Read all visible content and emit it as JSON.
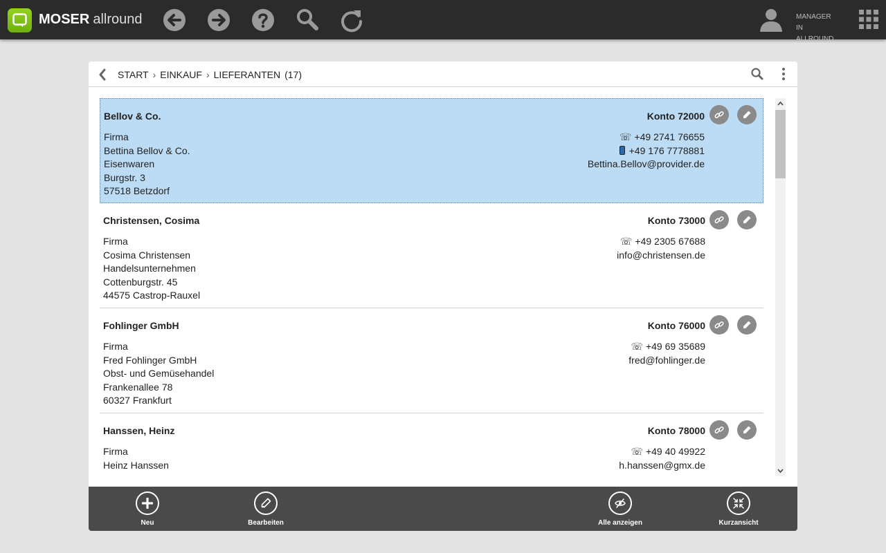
{
  "app": {
    "brand_bold": "MOSER",
    "brand_light": "allround"
  },
  "user": {
    "line1": "MANAGER",
    "line2": "IN ALLROUND"
  },
  "breadcrumb": {
    "items": [
      "START",
      "EINKAUF",
      "LIEFERANTEN"
    ],
    "separator": "›",
    "count": "(17)"
  },
  "records": [
    {
      "name": "Bellov & Co.",
      "konto": "Konto 72000",
      "lines": [
        "Firma",
        "Bettina Bellov & Co.",
        "Eisenwaren",
        "Burgstr. 3",
        "57518 Betzdorf"
      ],
      "phone_glyph": "☏",
      "phone": "+49 2741 76655",
      "mobile": "+49 176 7778881",
      "email": "Bettina.Bellov@provider.de",
      "selected": true
    },
    {
      "name": "Christensen, Cosima",
      "konto": "Konto 73000",
      "lines": [
        "Firma",
        "Cosima Christensen",
        "Handelsunternehmen",
        "Cottenburgstr. 45",
        "44575 Castrop-Rauxel"
      ],
      "phone_glyph": "☏",
      "phone": "+49 2305 67688",
      "email": "info@christensen.de"
    },
    {
      "name": "Fohlinger GmbH",
      "konto": "Konto 76000",
      "lines": [
        "Firma",
        "Fred Fohlinger GmbH",
        "Obst- und Gemüsehandel",
        "Frankenallee 78",
        "60327 Frankfurt"
      ],
      "phone_glyph": "☏",
      "phone": "+49 69 35689",
      "email": "fred@fohlinger.de"
    },
    {
      "name": "Hanssen, Heinz",
      "konto": "Konto 78000",
      "lines": [
        "Firma",
        "Heinz Hanssen"
      ],
      "phone_glyph": "☏",
      "phone": "+49 40 49922",
      "email": "h.hanssen@gmx.de"
    }
  ],
  "actions": {
    "new": "Neu",
    "edit": "Bearbeiten",
    "show_all": "Alle anzeigen",
    "compact": "Kurzansicht"
  },
  "colors": {
    "accent_green": "#7cc31a",
    "selected_row": "#bcdcf5",
    "topbar": "#2b2b2b",
    "bottombar": "#4a4a4a"
  },
  "icons": {
    "toolbar": [
      "back-icon",
      "forward-icon",
      "help-icon",
      "search-icon",
      "refresh-icon"
    ],
    "row_actions": [
      "link-icon",
      "pencil-icon"
    ]
  }
}
